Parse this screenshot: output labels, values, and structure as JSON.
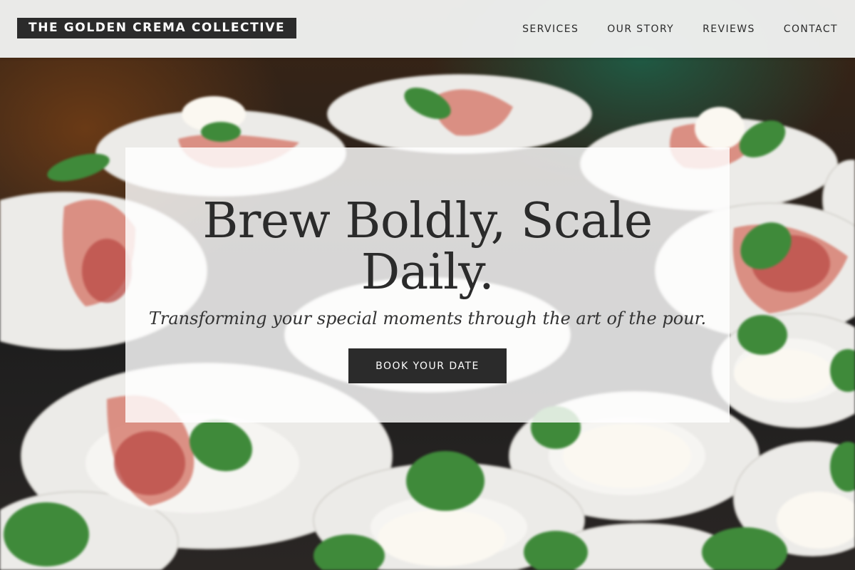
{
  "header": {
    "brand": "THE GOLDEN CREMA COLLECTIVE",
    "nav": [
      "SERVICES",
      "OUR STORY",
      "REVIEWS",
      "CONTACT"
    ]
  },
  "hero": {
    "title": "Brew Boldly, Scale Daily.",
    "subtitle": "Transforming your special moments through the art of the pour.",
    "cta_label": "BOOK YOUR DATE"
  },
  "colors": {
    "header_bg": "#f0f1f0",
    "logo_bg": "#2b2b2b",
    "button_bg": "#2b2b2b",
    "text_dark": "#2b2b2b"
  }
}
